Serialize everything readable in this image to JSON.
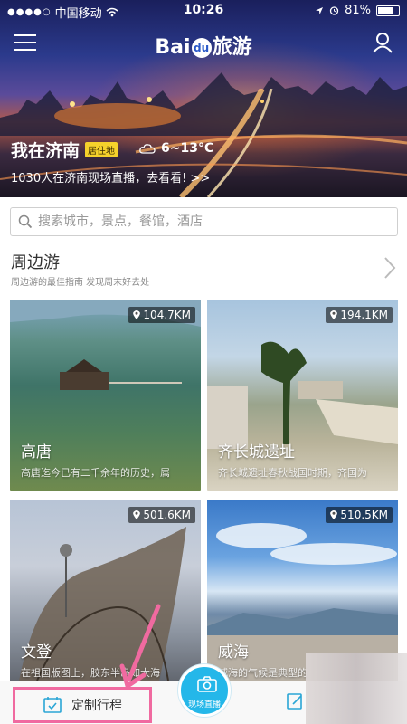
{
  "status_bar": {
    "signal_dots": "●●●●○",
    "carrier": "中国移动",
    "time": "10:26",
    "battery": "81%",
    "battery_level": 0.81
  },
  "header": {
    "logo_text_a": "Bai",
    "logo_paw": "du",
    "logo_text_b": "旅游"
  },
  "hero": {
    "city": "我在济南",
    "badge": "居住地",
    "weather": "6~13°C",
    "subtitle": "1030人在济南现场直播，去看看! >>"
  },
  "search": {
    "placeholder": "搜索城市，景点，餐馆，酒店"
  },
  "section": {
    "title": "周边游",
    "subtitle": "周边游的最佳指南 发现周末好去处"
  },
  "cards": [
    {
      "name": "高唐",
      "distance": "104.7KM",
      "desc": "高唐迄今已有二千余年的历史，属"
    },
    {
      "name": "齐长城遗址",
      "distance": "194.1KM",
      "desc": "齐长城遗址春秋战国时期，齐国为"
    },
    {
      "name": "文登",
      "distance": "501.6KM",
      "desc": "在祖国版图上，胶东半岛如大海"
    },
    {
      "name": "威海",
      "distance": "510.5KM",
      "desc": "威海的气候是典型的"
    }
  ],
  "bottom_bar": {
    "custom_trip": "定制行程",
    "live": "现场直播"
  },
  "colors": {
    "accent": "#24b7e9",
    "highlight": "#f06aa0",
    "badge": "#f5d22b"
  }
}
